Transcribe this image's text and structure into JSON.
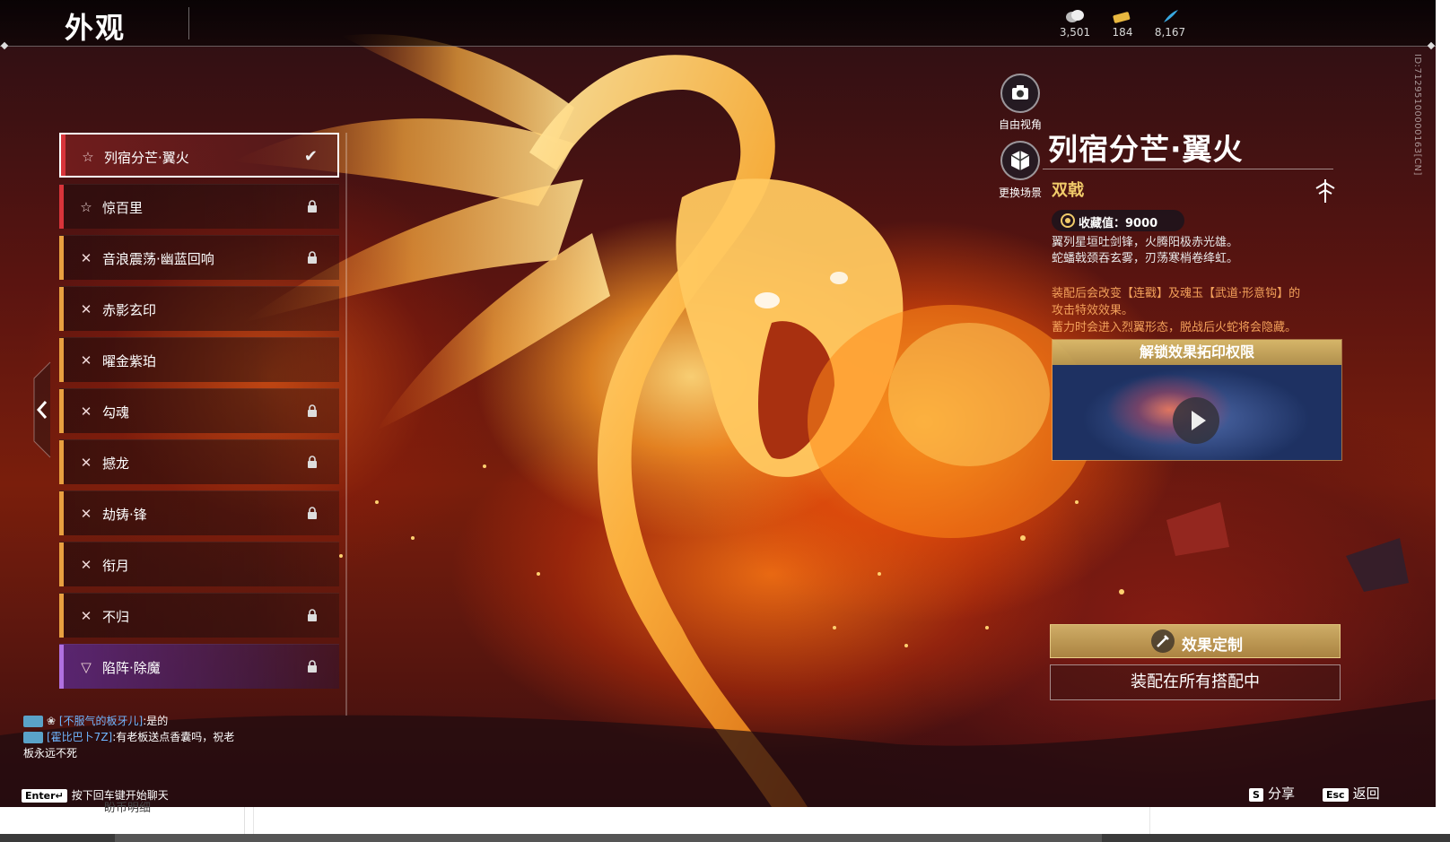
{
  "header": {
    "title": "外观",
    "currencies": [
      {
        "icon": "coin-icon",
        "value": "3,501"
      },
      {
        "icon": "ticket-icon",
        "value": "184"
      },
      {
        "icon": "feather-icon",
        "value": "8,167"
      }
    ]
  },
  "id_text": "ID:71295100000163[CN]",
  "list": {
    "items": [
      {
        "label": "列宿分芒·翼火",
        "icon": "star-icon",
        "state": "selected",
        "color": "#d8343a"
      },
      {
        "label": "惊百里",
        "icon": "star-icon",
        "state": "locked",
        "color": "#d8343a"
      },
      {
        "label": "音浪震荡·幽蓝回响",
        "icon": "cross-icon",
        "state": "locked",
        "color": "#e8a040"
      },
      {
        "label": "赤影玄印",
        "icon": "cross-icon",
        "state": "owned",
        "color": "#e8a040"
      },
      {
        "label": "曜金紫珀",
        "icon": "cross-icon",
        "state": "owned",
        "color": "#e8a040"
      },
      {
        "label": "勾魂",
        "icon": "cross-icon",
        "state": "locked",
        "color": "#e8a040"
      },
      {
        "label": "撼龙",
        "icon": "cross-icon",
        "state": "locked",
        "color": "#e8a040"
      },
      {
        "label": "劫铸·锋",
        "icon": "cross-icon",
        "state": "locked",
        "color": "#e8a040"
      },
      {
        "label": "衔月",
        "icon": "cross-icon",
        "state": "owned",
        "color": "#e8a040"
      },
      {
        "label": "不归",
        "icon": "cross-icon",
        "state": "locked",
        "color": "#e8a040"
      },
      {
        "label": "陷阵·除魔",
        "icon": "purple-emblem-icon",
        "state": "locked",
        "color": "#b070e0"
      }
    ]
  },
  "view_buttons": {
    "free_view": "自由视角",
    "change_scene": "更换场景"
  },
  "detail": {
    "name": "列宿分芒·翼火",
    "weapon_type": "双戟",
    "collection_value": "收藏值：9000",
    "description_line1": "翼列星垣吐剑锋，火腾阳极赤光雄。",
    "description_line2": "蛇蟠戟颈吞玄雾，刃荡寒梢卷绛虹。",
    "effect_line1": "装配后会改变【连戳】及魂玉【武道·形意钩】的",
    "effect_line2": "攻击特效效果。",
    "effect_line3": "蓄力时会进入烈翼形态，脱战后火蛇将会隐藏。",
    "unlock_title": "解锁效果拓印权限",
    "custom_button": "效果定制",
    "equip_button": "装配在所有搭配中"
  },
  "chat": {
    "line1_name": "[不服气的板牙儿]",
    "line1_msg": ":是的",
    "line2_name": "[霍比巴卜7Z]",
    "line2_msg": ":有老板送点香囊吗，祝老",
    "line3_msg": "板永远不死",
    "enter_key": "Enter↵",
    "enter_hint": "按下回车键开始聊天"
  },
  "bottom": {
    "share_key": "S",
    "share_label": "分享",
    "back_key": "Esc",
    "back_label": "返回"
  },
  "below": {
    "text": "盼币明细"
  },
  "colors": {
    "accent_gold": "#f1cb6a",
    "effect_orange": "#f3a05a",
    "chat_name_blue": "#6fb6ff"
  }
}
